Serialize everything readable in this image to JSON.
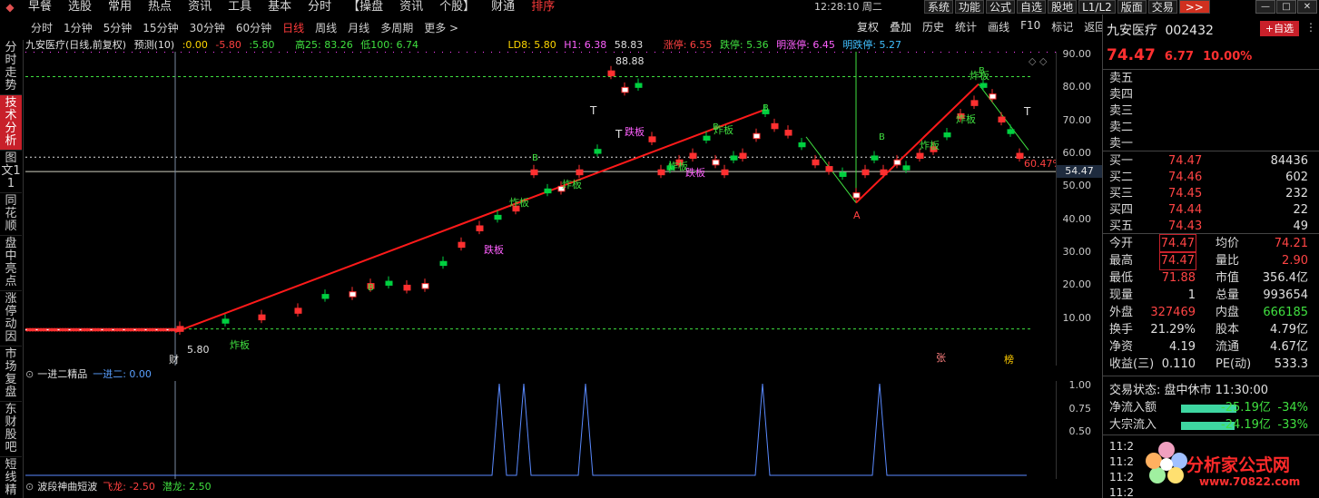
{
  "topmenu": {
    "items": [
      "早餐",
      "选股",
      "常用",
      "热点",
      "资讯",
      "工具",
      "基本",
      "分时",
      "【操盘",
      "资讯",
      "个股】",
      "财通",
      "排序"
    ],
    "time": "12:28:10 周二",
    "buttons": [
      "系统",
      "功能",
      "公式",
      "自选",
      "股地",
      "L1/L2",
      "版面",
      "交易"
    ],
    "hot": ">>"
  },
  "vtabs": [
    "分时走势",
    "技术分析",
    "图文11",
    "同花顺",
    "盘中亮点",
    "涨停动因",
    "市场复盘",
    "东财股吧",
    "短线精"
  ],
  "periods": [
    "分时",
    "1分钟",
    "5分钟",
    "15分钟",
    "30分钟",
    "60分钟",
    "日线",
    "周线",
    "月线",
    "多周期",
    "更多 >"
  ],
  "rightmenu": [
    "复权",
    "叠加",
    "历史",
    "统计",
    "画线",
    "F10",
    "标记",
    "返回"
  ],
  "info": {
    "name": "九安医疗(日线,前复权)",
    "pred": "预测(10)",
    "v1": ":0.00",
    "v2": "-5.80",
    "v3": ":5.80",
    "high": "高25: 83.26",
    "low": "低100: 6.74",
    "ld8": "LD8: 5.80",
    "h1": "H1: 6.38",
    "h1v": "58.83",
    "zt": "涨停: 6.55",
    "dt": "跌停: 5.36",
    "mzt": "明涨停: 6.45",
    "mdt": "明跌停: 5.27"
  },
  "yaxis": [
    "90.00",
    "80.00",
    "70.00",
    "60.00",
    "50.00",
    "40.00",
    "30.00",
    "20.00",
    "10.00"
  ],
  "curprice": "54.47",
  "chart_labels": {
    "top": "88.88",
    "pct": "60.47%",
    "bottom": "5.80",
    "cai": "财",
    "zhang": "张",
    "bang": "榜",
    "A1": "A",
    "A2": "A",
    "B": "B",
    "T": "T",
    "zhaban": "炸板",
    "dieban": "跌板"
  },
  "sub": {
    "name": "一进二精品",
    "series": "一进二: 0.00",
    "yaxis": [
      "1.00",
      "0.75",
      "0.50"
    ]
  },
  "sub2": {
    "name": "波段神曲短波",
    "fl": "飞龙: -2.50",
    "ql": "潜龙: 2.50"
  },
  "stock": {
    "name": "九安医疗",
    "code": "002432",
    "addbtn": "+自选",
    "price": "74.47",
    "chg": "6.77",
    "pct": "10.00%"
  },
  "sells": [
    "卖五",
    "卖四",
    "卖三",
    "卖二",
    "卖一"
  ],
  "buys": [
    {
      "l": "买一",
      "p": "74.47",
      "v": "84436"
    },
    {
      "l": "买二",
      "p": "74.46",
      "v": "602"
    },
    {
      "l": "买三",
      "p": "74.45",
      "v": "232"
    },
    {
      "l": "买四",
      "p": "74.44",
      "v": "22"
    },
    {
      "l": "买五",
      "p": "74.43",
      "v": "49"
    }
  ],
  "stats": [
    {
      "l1": "今开",
      "v1": "74.47",
      "l2": "均价",
      "v2": "74.21"
    },
    {
      "l1": "最高",
      "v1": "74.47",
      "l2": "量比",
      "v2": "2.90"
    },
    {
      "l1": "最低",
      "v1": "71.88",
      "l2": "市值",
      "v2": "356.4亿"
    },
    {
      "l1": "现量",
      "v1": "1",
      "l2": "总量",
      "v2": "993654"
    },
    {
      "l1": "外盘",
      "v1": "327469",
      "l2": "内盘",
      "v2": "666185"
    },
    {
      "l1": "换手",
      "v1": "21.29%",
      "l2": "股本",
      "v2": "4.79亿"
    },
    {
      "l1": "净资",
      "v1": "4.19",
      "l2": "流通",
      "v2": "4.67亿"
    },
    {
      "l1": "收益(三)",
      "v1": "0.110",
      "l2": "PE(动)",
      "v2": "533.3"
    }
  ],
  "trade_state": "交易状态: 盘中休市 11:30:00",
  "flows": [
    {
      "l": "净流入额",
      "v": "-25.19亿",
      "p": "-34%",
      "ratio": 0.34
    },
    {
      "l": "大宗流入",
      "v": "-24.19亿",
      "p": "-33%",
      "ratio": 0.33
    }
  ],
  "ticks": [
    "11:2",
    "11:2",
    "11:2",
    "11:2"
  ],
  "watermark": "分析家公式网",
  "watermark_url": "www.70822.com",
  "colors": {
    "up": "#ff3030",
    "down": "#00d040",
    "trend": "#ff1a1a",
    "accent": "#c8202a"
  }
}
